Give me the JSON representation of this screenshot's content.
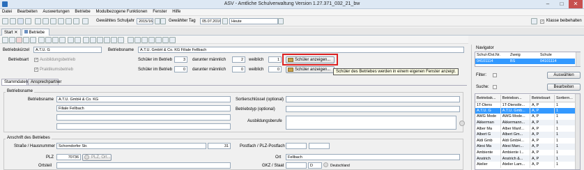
{
  "window": {
    "title": "ASV - Amtliche Schulverwaltung Version 1.27.371_032_21_bw"
  },
  "menu": [
    "Datei",
    "Bearbeiten",
    "Auswertungen",
    "Betriebe",
    "Modulbezogene Funktionen",
    "Fenster",
    "Hilfe"
  ],
  "toolbar": {
    "schuljahr_label": "Gewähltes Schuljahr",
    "schuljahr_value": "2015/16",
    "tag_label": "Gewählter Tag",
    "tag_value": "05.07.2016",
    "heute_value": "Heute",
    "klasse_label": "Klasse beibehalten"
  },
  "doc_tabs": [
    "Start",
    "Betriebe"
  ],
  "header": {
    "kuerzel_label": "Betriebskürzel",
    "kuerzel_value": "A.T.U. G",
    "name_label": "Betriebsname",
    "name_value": "A.T.U. GmbH & Co. KG Filiale Fellbach",
    "art_label": "Betriebsart",
    "ausbildungsbetrieb": "Ausbildungsbetrieb",
    "praktikumsbetrieb": "Praktikumsbetrieb",
    "row1": {
      "label": "Schüler im Betrieb",
      "count": "3",
      "m_label": "darunter männlich",
      "m_count": "2",
      "w_label": "weiblich",
      "w_count": "1"
    },
    "row2": {
      "label": "Schüler im Betrieb",
      "count": "0",
      "m_label": "darunter männlich",
      "m_count": "0",
      "w_label": "weiblich",
      "w_count": "0"
    },
    "show_button": "Schüler anzeigen...",
    "tooltip": "Schüler des Betriebes werden in einem eigenen Fenster anzeigt."
  },
  "subtabs": [
    "Stammdaten",
    "Ansprechpartner"
  ],
  "stammdaten": {
    "group_name": "Betriebsname",
    "betriebsname_label": "Betriebsname",
    "name_line1": "A.T.U. GmbH & Co. KG",
    "name_line2": "Filiale Fellbach",
    "sort_label": "Sortierschlüssel (optional)",
    "typ_label": "Betriebstyp (optional)",
    "berufe_label": "Ausbildungsberufe",
    "group_address": "Anschrift des Betriebes",
    "strasse_label": "Straße / Hausnummer",
    "strasse_value": "Schorndorfer Str.",
    "hausnr_value": "31",
    "postfach_label": "Postfach / PLZ-Postfach",
    "plz_label": "PLZ",
    "plz_value": "70736",
    "plz_button": "PLZ, Ort...",
    "ort_label": "Ort",
    "ort_value": "Fellbach",
    "ortsteil_label": "Ortsteil",
    "gkz_label": "GKZ / Staat",
    "staat_code": "D",
    "staat_name": "Deutschland"
  },
  "navigator": {
    "title": "Navigator",
    "top_headers": [
      "Schul-/Dst.Nr.",
      "Zweig",
      "Schule"
    ],
    "top_row": [
      "04101114",
      "BS",
      "04101114"
    ],
    "filter_label": "Filter:",
    "suche_label": "Suche:",
    "auswaehlen": "Auswählen",
    "bearbeiten": "Bearbeiten",
    "headers": [
      "Betriebsk...",
      "Betriebsn...",
      "Betriebsart",
      "Sortiern..."
    ],
    "rows": [
      [
        "1T-Diens",
        "1T-Dienstle...",
        "A, P",
        "1"
      ],
      [
        "A.T.U. G",
        "A.T.U. Gmb...",
        "A, P",
        "1"
      ],
      [
        "AWG Mode",
        "AWG Mode...",
        "A, P",
        "1"
      ],
      [
        "Akkerman",
        "Akkermann...",
        "A, P",
        "1"
      ],
      [
        "Alber Ma",
        "Alber Manf...",
        "A, P",
        "1"
      ],
      [
        "Albert G",
        "Albert Gm...",
        "A, P",
        "1"
      ],
      [
        "Aldi Gmb",
        "Aldi GmbH...",
        "A, P",
        "1"
      ],
      [
        "Alesi Ma",
        "Alesi Marc...",
        "A, P",
        "1"
      ],
      [
        "Ambiente",
        "Ambiente I...",
        "A, P",
        "1"
      ],
      [
        "Anstrich",
        "Anstrich &...",
        "A, P",
        "1"
      ],
      [
        "Atelier",
        "Atelier Lam...",
        "A, P",
        "1"
      ]
    ]
  }
}
